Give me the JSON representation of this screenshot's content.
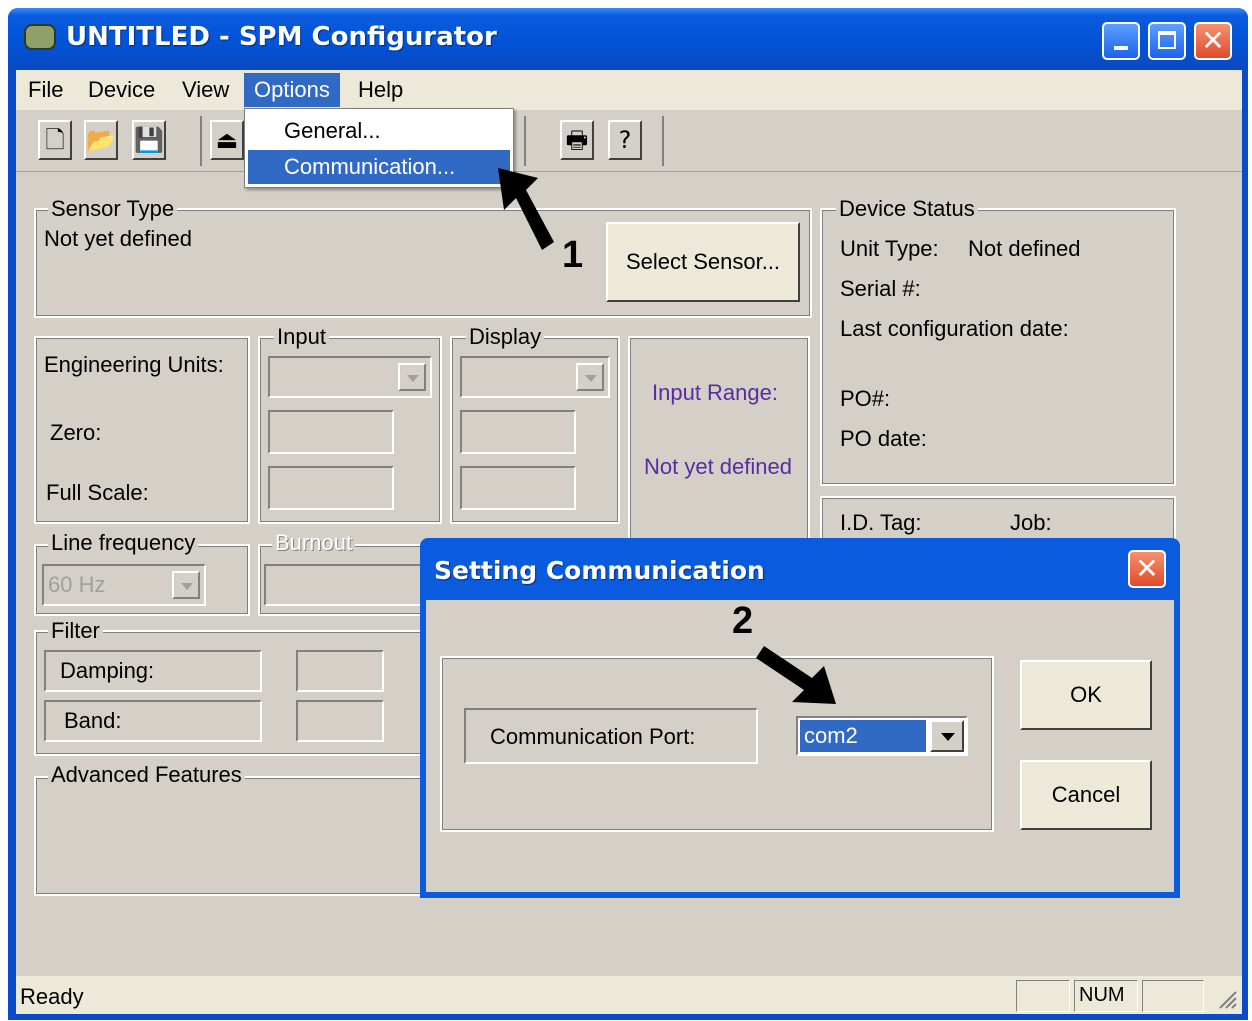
{
  "window": {
    "title": "UNTITLED - SPM Configurator"
  },
  "menubar": {
    "items": [
      "File",
      "Device",
      "View",
      "Options",
      "Help"
    ]
  },
  "options_menu": {
    "items": [
      "General...",
      "Communication..."
    ]
  },
  "sensor_type": {
    "title": "Sensor Type",
    "value": "Not yet defined",
    "select_button": "Select Sensor..."
  },
  "units": {
    "engineering_units_label": "Engineering Units:",
    "zero_label": "Zero:",
    "full_scale_label": "Full Scale:",
    "input_title": "Input",
    "display_title": "Display",
    "input_range_label": "Input Range:",
    "input_range_value": "Not yet defined"
  },
  "line_frequency": {
    "title": "Line frequency",
    "value": "60 Hz"
  },
  "burnout": {
    "title": "Burnout"
  },
  "filter": {
    "title": "Filter",
    "damping_label": "Damping:",
    "band_label": "Band:"
  },
  "advanced": {
    "title": "Advanced Features"
  },
  "device_status": {
    "title": "Device Status",
    "unit_type_label": "Unit Type:",
    "unit_type_value": "Not defined",
    "serial_label": "Serial #:",
    "last_config_label": "Last configuration date:",
    "po_label": "PO#:",
    "po_date_label": "PO date:"
  },
  "id_tag": {
    "label": "I.D. Tag:",
    "job_label": "Job:"
  },
  "dialog": {
    "title": "Setting Communication",
    "port_label": "Communication Port:",
    "port_value": "com2",
    "ok_label": "OK",
    "cancel_label": "Cancel"
  },
  "statusbar": {
    "text": "Ready",
    "num": "NUM"
  },
  "annotations": {
    "step1": "1",
    "step2": "2"
  },
  "colors": {
    "titlebar": "#0a5bde",
    "selection": "#316ac5",
    "input_range_text": "#5a2ca0"
  }
}
